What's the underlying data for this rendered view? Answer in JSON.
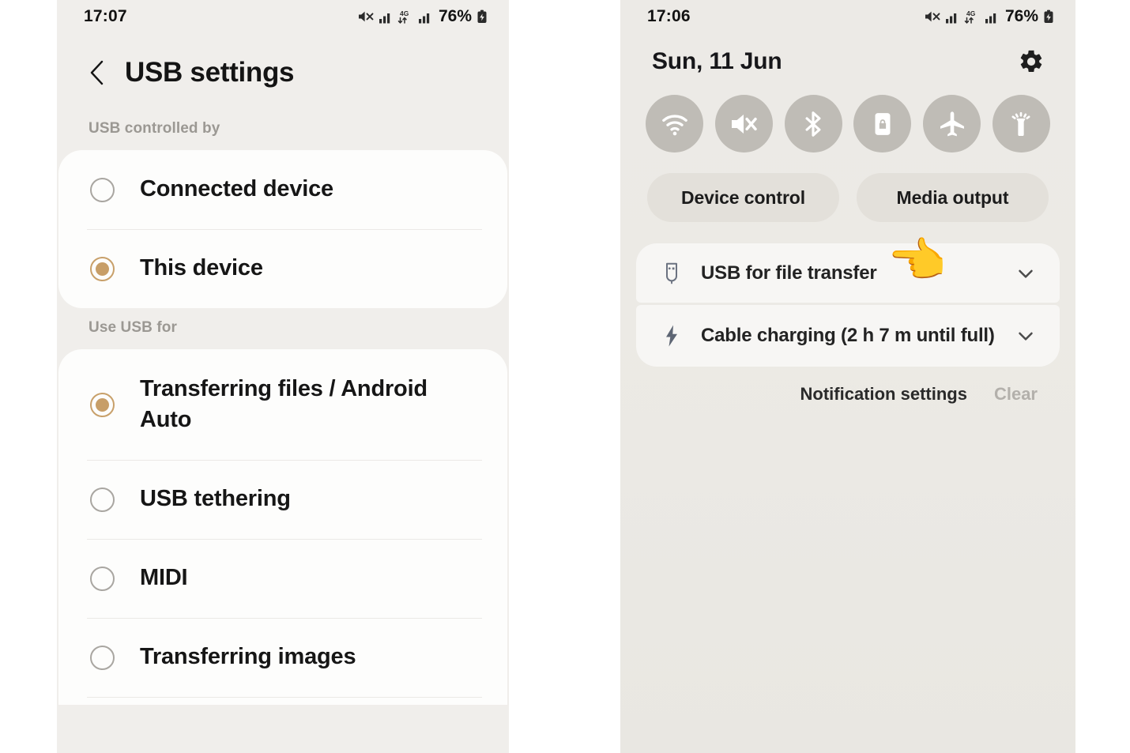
{
  "left_phone": {
    "statusbar": {
      "time": "17:07",
      "battery_percent": "76%",
      "network_label": "4G",
      "icons": [
        "mute-icon",
        "signal-bars-icon",
        "4g-data-icon",
        "signal-bars-icon",
        "battery-charging-icon"
      ]
    },
    "header": {
      "back_icon": "back-chevron-icon",
      "title": "USB settings"
    },
    "sections": [
      {
        "label": "USB controlled by",
        "options": [
          {
            "label": "Connected device",
            "selected": false
          },
          {
            "label": "This device",
            "selected": true
          }
        ]
      },
      {
        "label": "Use USB for",
        "options": [
          {
            "label": "Transferring files / Android Auto",
            "selected": true
          },
          {
            "label": "USB tethering",
            "selected": false
          },
          {
            "label": "MIDI",
            "selected": false
          },
          {
            "label": "Transferring images",
            "selected": false
          }
        ]
      }
    ]
  },
  "right_phone": {
    "statusbar": {
      "time": "17:06",
      "battery_percent": "76%",
      "network_label": "4G"
    },
    "header": {
      "date": "Sun, 11 Jun",
      "settings_icon": "gear-icon"
    },
    "toggles": [
      {
        "name": "wifi-toggle",
        "icon": "wifi-icon",
        "active": false
      },
      {
        "name": "sound-toggle",
        "icon": "mute-speaker-icon",
        "active": false
      },
      {
        "name": "bluetooth-toggle",
        "icon": "bluetooth-icon",
        "active": false
      },
      {
        "name": "auto-rotate-toggle",
        "icon": "rotation-lock-icon",
        "active": false
      },
      {
        "name": "airplane-mode-toggle",
        "icon": "airplane-icon",
        "active": false
      },
      {
        "name": "flashlight-toggle",
        "icon": "flashlight-icon",
        "active": false
      }
    ],
    "pills": [
      {
        "label": "Device control"
      },
      {
        "label": "Media output"
      }
    ],
    "notifications": [
      {
        "icon": "usb-icon",
        "title": "USB for file transfer",
        "expand_icon": "chevron-down-icon",
        "pointer_emoji": "👉"
      },
      {
        "icon": "lightning-bolt-icon",
        "title": "Cable charging (2 h 7 m until full)",
        "expand_icon": "chevron-down-icon"
      }
    ],
    "actions": {
      "notification_settings": "Notification settings",
      "clear": "Clear"
    }
  },
  "colors": {
    "accent_selected": "#c79e68",
    "panel_background": "#f0eeeb",
    "card_background": "#fdfdfc",
    "quickpanel_background": "#eceae6",
    "toggle_inactive": "#bfbcb6",
    "section_label": "#9b9893",
    "muted_action": "#b3b0ab"
  }
}
